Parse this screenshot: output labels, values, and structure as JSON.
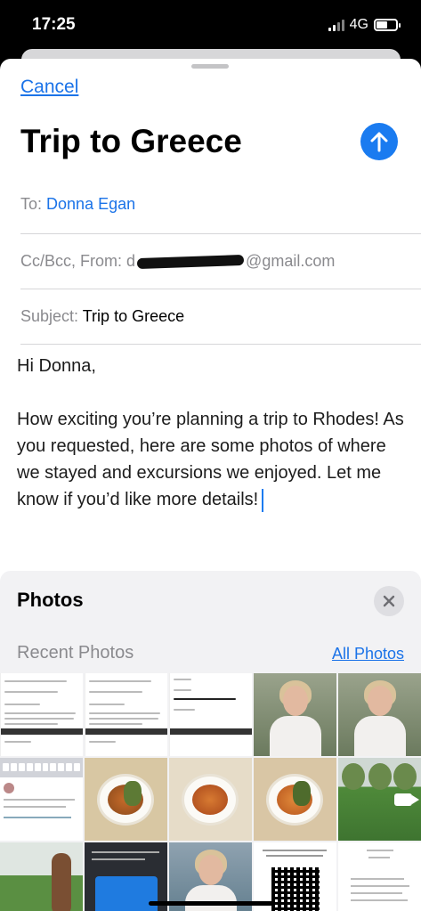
{
  "status_bar": {
    "time": "17:25",
    "network": "4G"
  },
  "compose": {
    "cancel_label": "Cancel",
    "title": "Trip to Greece",
    "to_label": "To:",
    "to_value": "Donna Egan",
    "ccbcc_label": "Cc/Bcc, From:",
    "from_prefix": "d",
    "from_domain": "@gmail.com",
    "subject_label": "Subject:",
    "subject_value": "Trip to Greece",
    "greeting": "Hi Donna,",
    "body": "How exciting you’re planning a trip to Rhodes!  As you requested, here are some photos of where we stayed and excursions we enjoyed. Let me know if you’d like more details!"
  },
  "photos_panel": {
    "title": "Photos",
    "recent_label": "Recent Photos",
    "all_photos_label": "All Photos"
  },
  "colors": {
    "accent": "#1b73e8",
    "send_button": "#1a7bf0"
  },
  "icons": {
    "send": "arrow-up-icon",
    "close": "close-icon",
    "video": "video-camera-icon"
  }
}
